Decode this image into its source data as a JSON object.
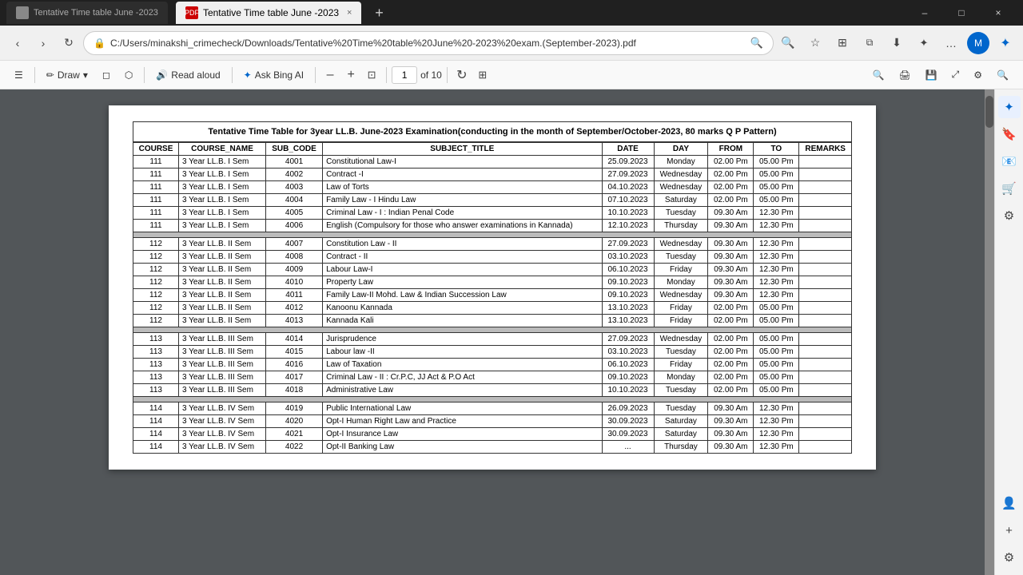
{
  "titleBar": {
    "tab": {
      "label": "Tentative Time table June -2023",
      "close": "×"
    },
    "newTab": "+",
    "controls": {
      "minimize": "–",
      "maximize": "□",
      "close": "×"
    }
  },
  "navBar": {
    "back": "‹",
    "forward": "›",
    "refresh": "↻",
    "addressLock": "🔒",
    "addressUrl": "C:/Users/minakshi_crimecheck/Downloads/Tentative%20Time%20table%20June%20-2023%20exam.(September-2023).pdf",
    "searchIcon": "🔍",
    "favoriteIcon": "☆",
    "splitIcon": "⊞",
    "extensionIcon": "⧉",
    "downloadIcon": "⬇",
    "collectionIcon": "✦",
    "moreIcon": "…",
    "profileIcon": "M"
  },
  "toolbar": {
    "menuIcon": "☰",
    "draw": "Draw",
    "drawChevron": "▾",
    "eraser": "✏",
    "highlight": "⬡",
    "readAloud": "Read aloud",
    "separator1": "|",
    "askBingAI": "Ask Bing AI",
    "zoomOut": "–",
    "zoomIn": "+",
    "fitPage": "⊡",
    "currentPage": "1",
    "totalPages": "of 10",
    "rotate": "↻",
    "fitWidth": "⊞",
    "searchBtn": "🔍",
    "print": "🖨",
    "save": "💾",
    "fullscreen": "⤢",
    "settings": "⚙",
    "searchSidebar": "🔍"
  },
  "table": {
    "title": "Tentative  Time Table for 3year LL.B. June-2023 Examination(conducting in the month of September/October-2023, 80 marks  Q P Pattern)",
    "headers": [
      "COURSE",
      "COURSE_NAME",
      "SUB_CODE",
      "SUBJECT_TITLE",
      "DATE",
      "DAY",
      "FROM",
      "TO",
      "REMARKS"
    ],
    "groups": [
      {
        "rows": [
          [
            "111",
            "3 Year LL.B. I Sem",
            "4001",
            "Constitutional Law-I",
            "25.09.2023",
            "Monday",
            "02.00 Pm",
            "05.00 Pm",
            ""
          ],
          [
            "111",
            "3 Year LL.B. I Sem",
            "4002",
            "Contract -I",
            "27.09.2023",
            "Wednesday",
            "02.00 Pm",
            "05.00 Pm",
            ""
          ],
          [
            "111",
            "3 Year LL.B. I Sem",
            "4003",
            "Law of Torts",
            "04.10.2023",
            "Wednesday",
            "02.00 Pm",
            "05.00 Pm",
            ""
          ],
          [
            "111",
            "3 Year LL.B. I Sem",
            "4004",
            "Family Law - I Hindu Law",
            "07.10.2023",
            "Saturday",
            "02.00 Pm",
            "05.00 Pm",
            ""
          ],
          [
            "111",
            "3 Year LL.B. I Sem",
            "4005",
            "Criminal Law - I : Indian Penal Code",
            "10.10.2023",
            "Tuesday",
            "09.30 Am",
            "12.30 Pm",
            ""
          ],
          [
            "111",
            "3 Year LL.B. I Sem",
            "4006",
            "English (Compulsory for those who answer examinations in Kannada)",
            "12.10.2023",
            "Thursday",
            "09.30 Am",
            "12.30 Pm",
            ""
          ]
        ]
      },
      {
        "rows": [
          [
            "112",
            "3 Year LL.B. II Sem",
            "4007",
            "Constitution Law - II",
            "27.09.2023",
            "Wednesday",
            "09.30 Am",
            "12.30 Pm",
            ""
          ],
          [
            "112",
            "3 Year LL.B. II Sem",
            "4008",
            "Contract - II",
            "03.10.2023",
            "Tuesday",
            "09.30 Am",
            "12.30 Pm",
            ""
          ],
          [
            "112",
            "3 Year LL.B. II Sem",
            "4009",
            "Labour Law-I",
            "06.10.2023",
            "Friday",
            "09.30 Am",
            "12.30 Pm",
            ""
          ],
          [
            "112",
            "3 Year LL.B. II Sem",
            "4010",
            "Property Law",
            "09.10.2023",
            "Monday",
            "09.30 Am",
            "12.30 Pm",
            ""
          ],
          [
            "112",
            "3 Year LL.B. II Sem",
            "4011",
            "Family Law-II Mohd. Law & Indian Succession Law",
            "09.10.2023",
            "Wednesday",
            "09.30 Am",
            "12.30 Pm",
            ""
          ],
          [
            "112",
            "3 Year LL.B. II Sem",
            "4012",
            "Kanoonu Kannada",
            "13.10.2023",
            "Friday",
            "02.00 Pm",
            "05.00 Pm",
            ""
          ],
          [
            "112",
            "3 Year LL.B. II Sem",
            "4013",
            "Kannada Kali",
            "13.10.2023",
            "Friday",
            "02.00 Pm",
            "05.00 Pm",
            ""
          ]
        ]
      },
      {
        "rows": [
          [
            "113",
            "3 Year LL.B. III Sem",
            "4014",
            "Jurisprudence",
            "27.09.2023",
            "Wednesday",
            "02.00 Pm",
            "05.00 Pm",
            ""
          ],
          [
            "113",
            "3 Year LL.B. III Sem",
            "4015",
            "Labour law -II",
            "03.10.2023",
            "Tuesday",
            "02.00 Pm",
            "05.00 Pm",
            ""
          ],
          [
            "113",
            "3 Year LL.B. III Sem",
            "4016",
            "Law of Taxation",
            "06.10.2023",
            "Friday",
            "02.00 Pm",
            "05.00 Pm",
            ""
          ],
          [
            "113",
            "3 Year LL.B. III Sem",
            "4017",
            "Criminal Law - II : Cr.P.C, JJ Act & P.O Act",
            "09.10.2023",
            "Monday",
            "02.00 Pm",
            "05.00 Pm",
            ""
          ],
          [
            "113",
            "3 Year LL.B. III Sem",
            "4018",
            "Administrative Law",
            "10.10.2023",
            "Tuesday",
            "02.00 Pm",
            "05.00 Pm",
            ""
          ]
        ]
      },
      {
        "rows": [
          [
            "114",
            "3 Year LL.B. IV Sem",
            "4019",
            "Public International Law",
            "26.09.2023",
            "Tuesday",
            "09.30 Am",
            "12.30 Pm",
            ""
          ],
          [
            "114",
            "3 Year LL.B. IV Sem",
            "4020",
            "Opt-I Human Right Law and Practice",
            "30.09.2023",
            "Saturday",
            "09.30 Am",
            "12.30 Pm",
            ""
          ],
          [
            "114",
            "3 Year LL.B. IV Sem",
            "4021",
            "Opt-I Insurance Law",
            "30.09.2023",
            "Saturday",
            "09.30 Am",
            "12.30 Pm",
            ""
          ],
          [
            "114",
            "3 Year LL.B. IV Sem",
            "4022",
            "Opt-II Banking Law",
            "...",
            "Thursday",
            "09.30 Am",
            "12.30 Pm",
            ""
          ]
        ]
      }
    ]
  },
  "edgeSidebar": {
    "icons": [
      "🔖",
      "📧",
      "🛒",
      "⚙",
      "👤",
      "+"
    ]
  }
}
